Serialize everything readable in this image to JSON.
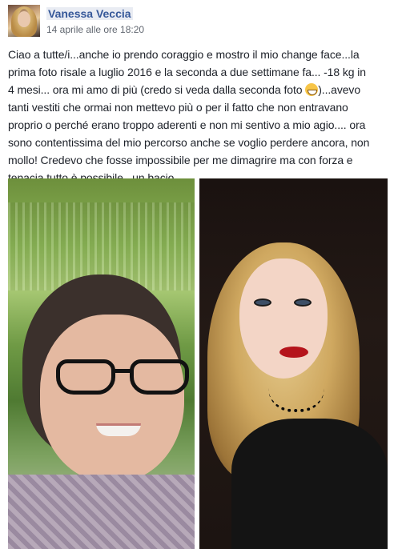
{
  "post": {
    "author": "Vanessa Veccia",
    "timestamp": "14 aprile alle ore 18:20",
    "text_lines": [
      "Ciao a tutte/i...anche io prendo coraggio e mostro il mio change face...la",
      "prima foto risale a luglio 2016 e la seconda a due settimane fa... -18 kg in",
      "4 mesi... ora mi amo di più (credo si veda dalla seconda foto ",
      ")...avevo",
      "tanti vestiti che ormai non mettevo più o per il fatto che non entravano",
      "proprio o perché erano troppo aderenti e non mi sentivo a mio agio.... ora",
      "sono contentissima del mio percorso anche se voglio perdere ancora, non",
      "mollo! Credevo che fosse impossibile per me dimagrire ma con forza e",
      "tenacia tutto è possibile...un bacio..."
    ],
    "emoji": "grinning-face-icon"
  },
  "colors": {
    "author_link": "#365899",
    "timestamp": "#616770",
    "text": "#1d2129",
    "author_highlight": "#e9ecf3"
  }
}
